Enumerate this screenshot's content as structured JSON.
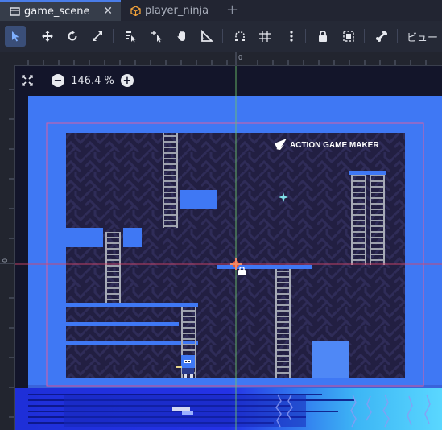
{
  "tabs": [
    {
      "label": "game_scene",
      "icon": "scene-icon"
    },
    {
      "label": "player_ninja",
      "icon": "cube-icon"
    }
  ],
  "toolbar": {
    "tools": [
      "select-tool",
      "move-tool",
      "rotate-tool",
      "scale-tool",
      "list-select-tool",
      "pivot-tool",
      "pan-tool",
      "ruler-tool",
      "smart-snap-tool",
      "grid-snap-tool",
      "more-options",
      "lock-tool",
      "group-tool",
      "bone-tool"
    ],
    "view_menu_label": "ビュー"
  },
  "zoom": {
    "value": "146.4 %"
  },
  "ruler": {
    "top_zero": "0",
    "left_zero": "0"
  },
  "logo": {
    "text": "ACTION GAME MAKER"
  },
  "colors": {
    "accent": "#4a7de8",
    "level_blue": "#3d74f0",
    "tile_dark": "#242145",
    "ladder": "#a0a4b0"
  }
}
